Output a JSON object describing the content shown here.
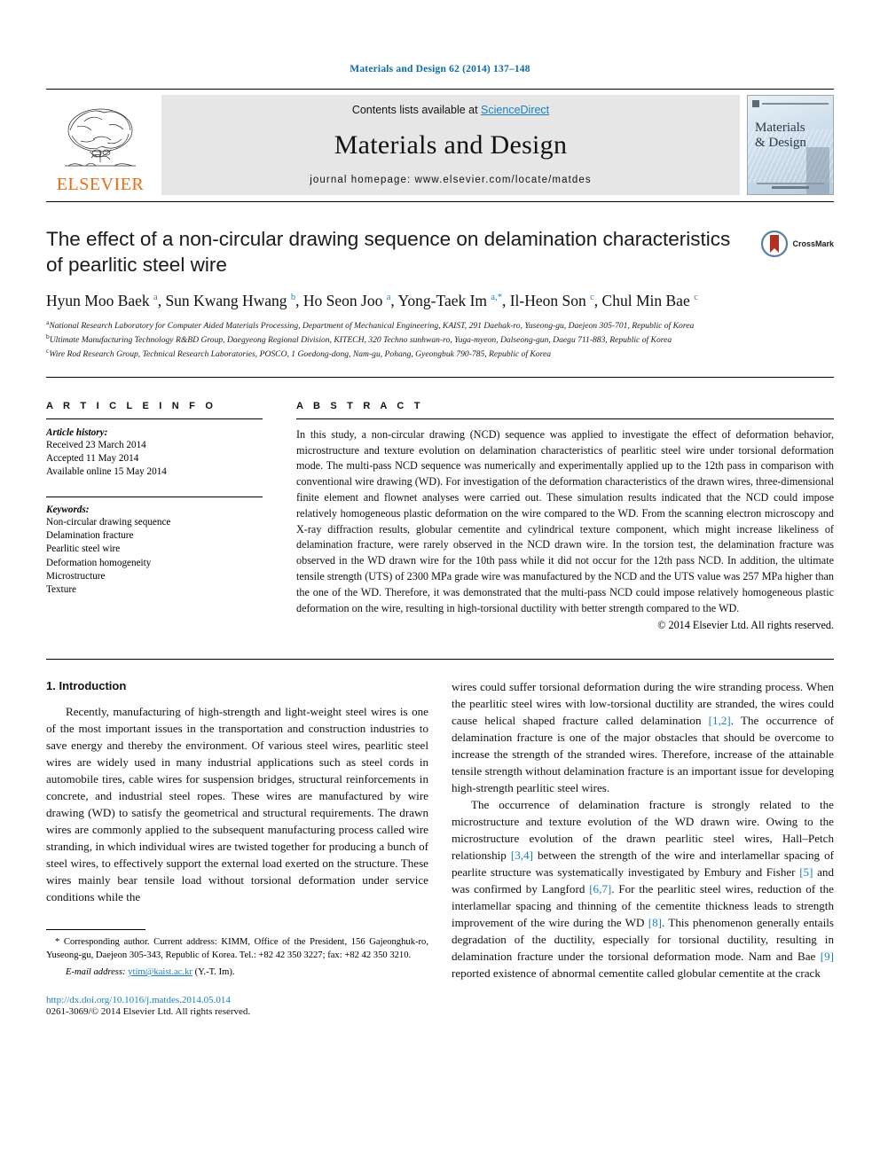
{
  "running_head": "Materials and Design 62 (2014) 137–148",
  "header": {
    "publisher_name": "ELSEVIER",
    "contents_prefix": "Contents lists available at ",
    "contents_link": "ScienceDirect",
    "journal_title": "Materials and Design",
    "homepage": "journal homepage: www.elsevier.com/locate/matdes",
    "cover_title_line1": "Materials",
    "cover_title_line2": "& Design"
  },
  "article": {
    "title": "The effect of a non-circular drawing sequence on delamination characteristics of pearlitic steel wire",
    "crossmark_label": "CrossMark",
    "authors_html": "Hyun Moo Baek <sup>a</sup>, Sun Kwang Hwang <sup>b</sup>, Ho Seon Joo <sup>a</sup>, Yong-Taek Im <sup>a,</sup><sup class=\"star\">*</sup>, Il-Heon Son <sup>c</sup>, Chul Min Bae <sup>c</sup>",
    "affiliations": [
      "National Research Laboratory for Computer Aided Materials Processing, Department of Mechanical Engineering, KAIST, 291 Daehak-ro, Yuseong-gu, Daejeon 305-701, Republic of Korea",
      "Ultimate Manufacturing Technology R&BD Group, Daegyeong Regional Division, KITECH, 320 Techno sunhwan-ro, Yuga-myeon, Dalseong-gun, Daegu 711-883, Republic of Korea",
      "Wire Rod Research Group, Technical Research Laboratories, POSCO, 1 Goedong-dong, Nam-gu, Pohang, Gyeongbuk 790-785, Republic of Korea"
    ],
    "affiliation_marks": [
      "a",
      "b",
      "c"
    ]
  },
  "article_info": {
    "heading": "A R T I C L E   I N F O",
    "history_label": "Article history:",
    "history": [
      "Received 23 March 2014",
      "Accepted 11 May 2014",
      "Available online 15 May 2014"
    ],
    "keywords_label": "Keywords:",
    "keywords": [
      "Non-circular drawing sequence",
      "Delamination fracture",
      "Pearlitic steel wire",
      "Deformation homogeneity",
      "Microstructure",
      "Texture"
    ]
  },
  "abstract": {
    "heading": "A B S T R A C T",
    "text": "In this study, a non-circular drawing (NCD) sequence was applied to investigate the effect of deformation behavior, microstructure and texture evolution on delamination characteristics of pearlitic steel wire under torsional deformation mode. The multi-pass NCD sequence was numerically and experimentally applied up to the 12th pass in comparison with conventional wire drawing (WD). For investigation of the deformation characteristics of the drawn wires, three-dimensional finite element and flownet analyses were carried out. These simulation results indicated that the NCD could impose relatively homogeneous plastic deformation on the wire compared to the WD. From the scanning electron microscopy and X-ray diffraction results, globular cementite and cylindrical texture component, which might increase likeliness of delamination fracture, were rarely observed in the NCD drawn wire. In the torsion test, the delamination fracture was observed in the WD drawn wire for the 10th pass while it did not occur for the 12th pass NCD. In addition, the ultimate tensile strength (UTS) of 2300 MPa grade wire was manufactured by the NCD and the UTS value was 257 MPa higher than the one of the WD. Therefore, it was demonstrated that the multi-pass NCD could impose relatively homogeneous plastic deformation on the wire, resulting in high-torsional ductility with better strength compared to the WD.",
    "copyright": "© 2014 Elsevier Ltd. All rights reserved."
  },
  "body": {
    "section_title": "1. Introduction",
    "left_paragraphs": [
      "Recently, manufacturing of high-strength and light-weight steel wires is one of the most important issues in the transportation and construction industries to save energy and thereby the environment. Of various steel wires, pearlitic steel wires are widely used in many industrial applications such as steel cords in automobile tires, cable wires for suspension bridges, structural reinforcements in concrete, and industrial steel ropes. These wires are manufactured by wire drawing (WD) to satisfy the geometrical and structural requirements. The drawn wires are commonly applied to the subsequent manufacturing process called wire stranding, in which individual wires are twisted together for producing a bunch of steel wires, to effectively support the external load exerted on the structure. These wires mainly bear tensile load without torsional deformation under service conditions while the"
    ],
    "right_paragraph_1_html": "wires could suffer torsional deformation during the wire stranding process. When the pearlitic steel wires with low-torsional ductility are stranded, the wires could cause helical shaped fracture called delamination <span class=\"ref\">[1,2]</span>. The occurrence of delamination fracture is one of the major obstacles that should be overcome to increase the strength of the stranded wires. Therefore, increase of the attainable tensile strength without delamination fracture is an important issue for developing high-strength pearlitic steel wires.",
    "right_paragraph_2_html": "The occurrence of delamination fracture is strongly related to the microstructure and texture evolution of the WD drawn wire. Owing to the microstructure evolution of the drawn pearlitic steel wires, Hall–Petch relationship <span class=\"ref\">[3,4]</span> between the strength of the wire and interlamellar spacing of pearlite structure was systematically investigated by Embury and Fisher <span class=\"ref\">[5]</span> and was confirmed by Langford <span class=\"ref\">[6,7]</span>. For the pearlitic steel wires, reduction of the interlamellar spacing and thinning of the cementite thickness leads to strength improvement of the wire during the WD <span class=\"ref\">[8]</span>. This phenomenon generally entails degradation of the ductility, especially for torsional ductility, resulting in delamination fracture under the torsional deformation mode. Nam and Bae <span class=\"ref\">[9]</span> reported existence of abnormal cementite called globular cementite at the crack"
  },
  "footnotes": {
    "corresponding_html": "<span class=\"lead\">* Corresponding author. Current address: KIMM, Office of the President, 156 Gajeonghuk-ro, Yuseong-gu, Daejeon 305-343, Republic of Korea. Tel.: +82 42 350 3227; fax: +82 42 350 3210.</span>",
    "email_label": "E-mail address:",
    "email": "ytim@kaist.ac.kr",
    "email_suffix": "(Y.-T. Im).",
    "doi": "http://dx.doi.org/10.1016/j.matdes.2014.05.014",
    "issn": "0261-3069/© 2014 Elsevier Ltd. All rights reserved."
  },
  "colors": {
    "link_blue": "#1a7fc1",
    "running_head_blue": "#0b6ba8",
    "elsevier_orange": "#ea6c14",
    "band_gray": "#e6e6e6"
  }
}
